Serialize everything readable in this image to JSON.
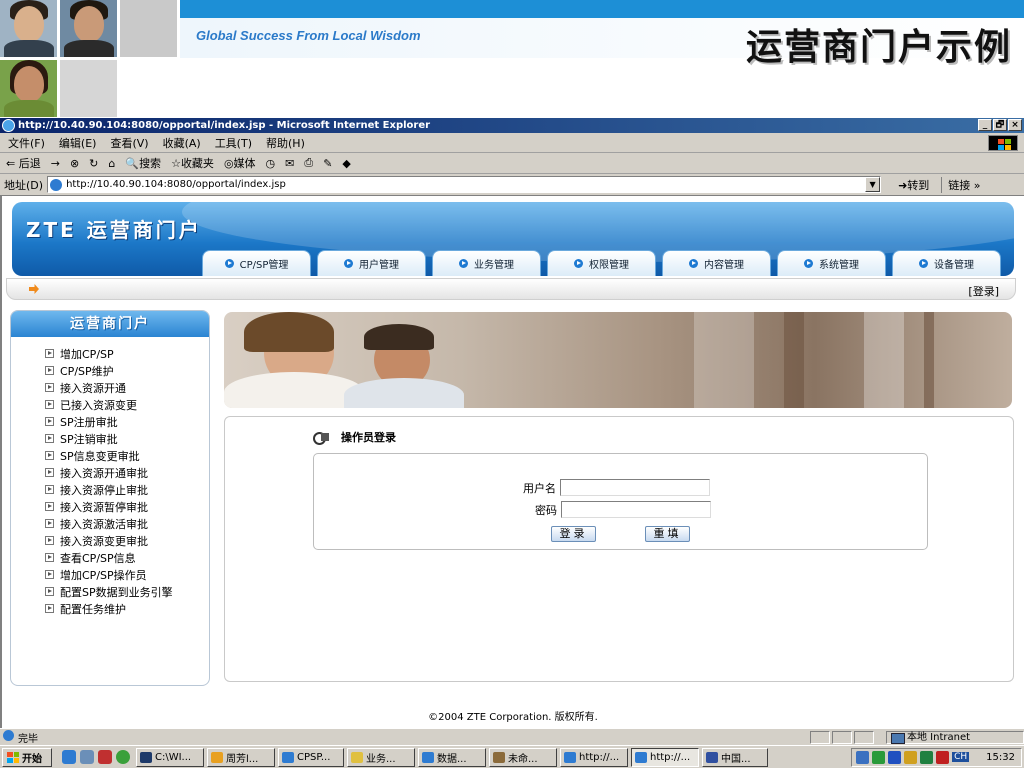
{
  "slide": {
    "tagline": "Global Success From Local Wisdom",
    "title": "运营商门户示例"
  },
  "ie": {
    "title": "http://10.40.90.104:8080/opportal/index.jsp - Microsoft Internet Explorer",
    "window_buttons": [
      "_",
      "🗗",
      "×"
    ],
    "menu": [
      "文件(F)",
      "编辑(E)",
      "查看(V)",
      "收藏(A)",
      "工具(T)",
      "帮助(H)"
    ],
    "toolbar": {
      "back": "⇐ 后退",
      "forward": "→",
      "stop": "⊗",
      "refresh": "↻",
      "home": "⌂",
      "search": "搜索",
      "favorites": "收藏夹",
      "media": "媒体",
      "history": "◷",
      "mail": "✉",
      "print": "⎙",
      "edit": "✎",
      "messenger": "◆"
    },
    "address_label": "地址(D)",
    "address_value": "http://10.40.90.104:8080/opportal/index.jsp",
    "goto_label": "转到",
    "links_label": "链接 »"
  },
  "portal": {
    "brand": "ZTE 运营商门户",
    "tabs": [
      "CP/SP管理",
      "用户管理",
      "业务管理",
      "权限管理",
      "内容管理",
      "系统管理",
      "设备管理"
    ],
    "login_link": "[登录]",
    "sidebar_title": "运营商门户",
    "sidebar_items": [
      "增加CP/SP",
      "CP/SP维护",
      "接入资源开通",
      "已接入资源变更",
      "SP注册审批",
      "SP注销审批",
      "SP信息变更审批",
      "接入资源开通审批",
      "接入资源停止审批",
      "接入资源暂停审批",
      "接入资源激活审批",
      "接入资源变更审批",
      "查看CP/SP信息",
      "增加CP/SP操作员",
      "配置SP数据到业务引擎",
      "配置任务维护"
    ],
    "login_title": "操作员登录",
    "username_label": "用户名",
    "password_label": "密码",
    "username_value": "",
    "password_value": "",
    "login_button": "登录",
    "reset_button": "重填",
    "copyright": "©2004 ZTE Corporation. 版权所有."
  },
  "status": {
    "text": "完毕",
    "zone": "本地 Intranet"
  },
  "taskbar": {
    "start": "开始",
    "tasks": [
      "C:\\WI...",
      "周芳l...",
      "CPSP...",
      "业务...",
      "数据...",
      "未命...",
      "http://...",
      "http://...",
      "中国..."
    ],
    "active_task_index": 7,
    "clock": "15:32",
    "ime": "CH"
  }
}
